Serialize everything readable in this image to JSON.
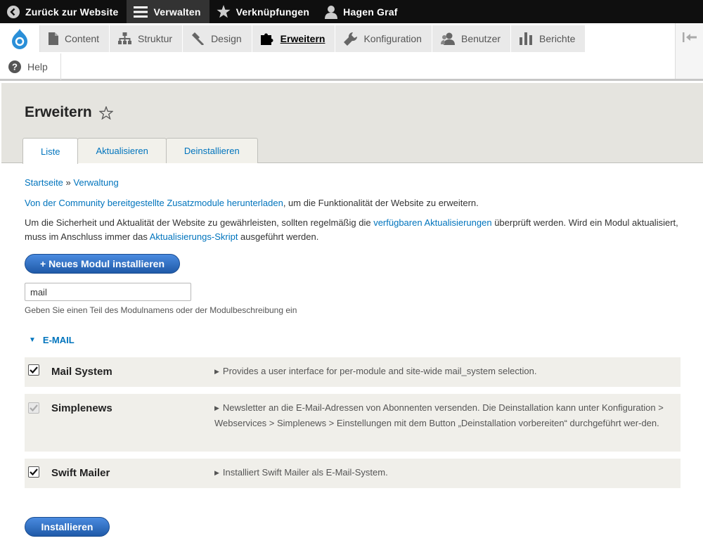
{
  "toolbar": {
    "back_label": "Zurück zur Website",
    "manage_label": "Verwalten",
    "shortcuts_label": "Verknüpfungen",
    "user_label": "Hagen Graf"
  },
  "menu": {
    "items": [
      {
        "label": "Content",
        "icon": "file-icon"
      },
      {
        "label": "Struktur",
        "icon": "sitemap-icon"
      },
      {
        "label": "Design",
        "icon": "paintbrush-icon"
      },
      {
        "label": "Erweitern",
        "icon": "puzzle-icon",
        "active": true
      },
      {
        "label": "Konfiguration",
        "icon": "wrench-icon"
      },
      {
        "label": "Benutzer",
        "icon": "people-icon"
      },
      {
        "label": "Berichte",
        "icon": "bar-chart-icon"
      }
    ],
    "help_label": "Help"
  },
  "page": {
    "title": "Erweitern",
    "tabs": [
      "Liste",
      "Aktualisieren",
      "Deinstallieren"
    ]
  },
  "breadcrumb": {
    "home": "Startseite",
    "separator": "»",
    "admin": "Verwaltung"
  },
  "intro": {
    "link1": "Von der Community bereitgestellte Zusatzmodule herunterladen",
    "text1": ", um die Funktionalität der Website zu erweitern.",
    "text2a": "Um die Sicherheit und Aktualität der Website zu gewährleisten, sollten regelmäßig die ",
    "link2": "verfügbaren Aktualisierungen",
    "text2b": " überprüft werden. Wird ein Modul aktualisiert, muss im Anschluss immer das ",
    "link3": "Aktualisierungs-Skript",
    "text2c": " ausgeführt werden."
  },
  "buttons": {
    "new_module": "+ Neues Modul installieren",
    "install": "Installieren"
  },
  "filter": {
    "value": "mail",
    "description": "Geben Sie einen Teil des Modulnamens oder der Modulbeschreibung ein"
  },
  "section": {
    "title": "E-MAIL"
  },
  "modules": [
    {
      "name": "Mail System",
      "checked": true,
      "disabled": false,
      "description": "Provides a user interface for per-module and site-wide mail_system selection."
    },
    {
      "name": "Simplenews",
      "checked": true,
      "disabled": true,
      "description": "Newsletter an die E-Mail-Adressen von Abonnenten versenden. Die Deinstallation kann unter Konfiguration > Webservices > Simplenews > Einstellungen mit dem Button „Deinstallation vorbereiten“ durchgeführt wer-den."
    },
    {
      "name": "Swift Mailer",
      "checked": true,
      "disabled": false,
      "description": "Installiert Swift Mailer als E-Mail-System."
    }
  ]
}
